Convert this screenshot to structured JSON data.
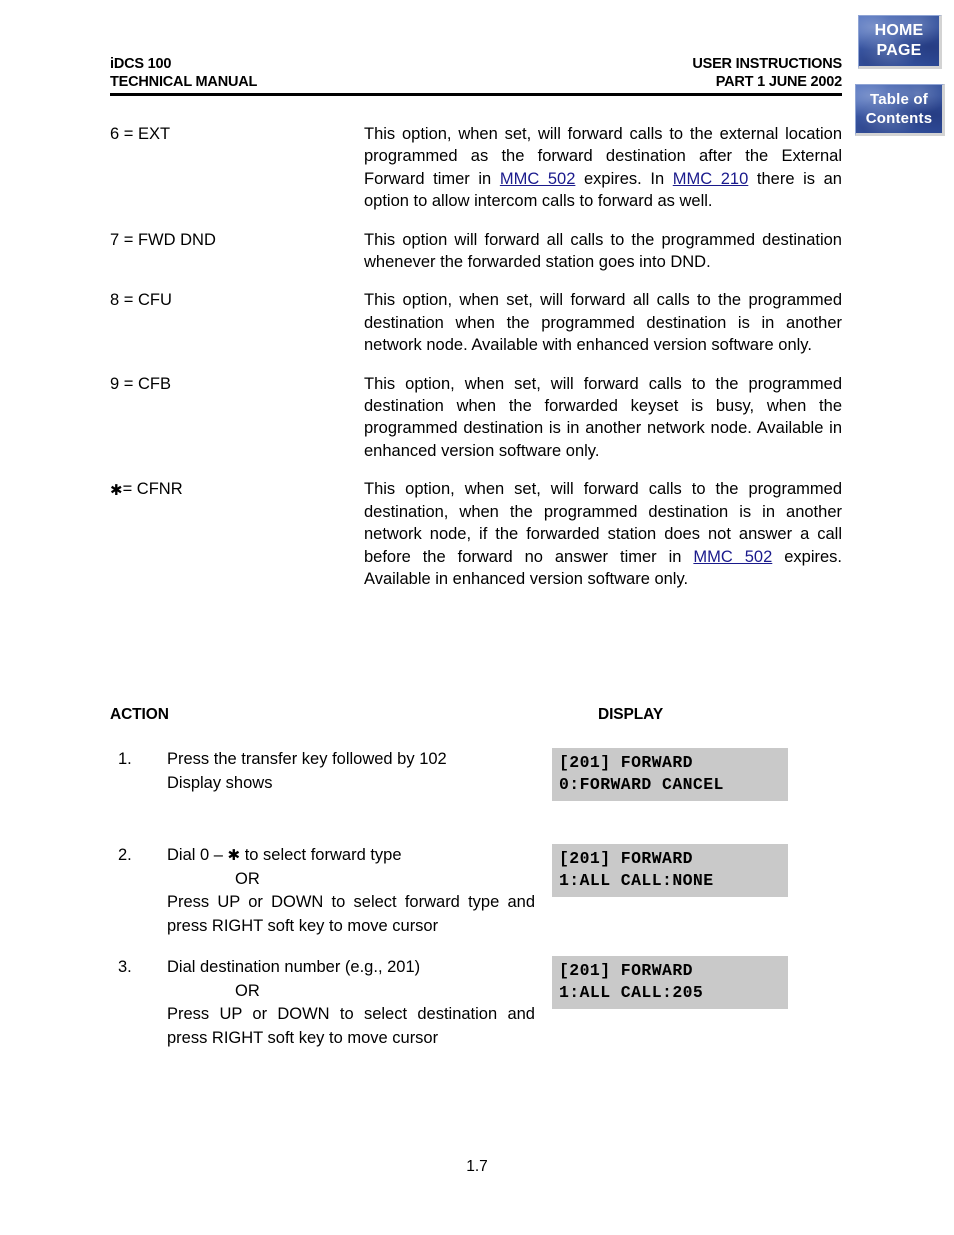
{
  "header": {
    "left_line1": "iDCS 100",
    "left_line2": "TECHNICAL MANUAL",
    "right_line1": "USER INSTRUCTIONS",
    "right_line2": "PART 1   JUNE  2002"
  },
  "nav_buttons": {
    "home_page": {
      "line1": "HOME",
      "line2": "PAGE",
      "color": "#3a5cab",
      "text_color": "#ffffff"
    },
    "table_of_contents": {
      "line1": "Table of",
      "line2": "Contents",
      "color": "#3a5cab",
      "text_color": "#ffffff"
    }
  },
  "link_color": "#1a1a8c",
  "display_bg_color": "#c9c9c9",
  "options": [
    {
      "term": "6 = EXT",
      "star": false,
      "definition_parts": [
        {
          "text": "This option, when set, will forward calls to the external location programmed as the forward destination after the External Forward timer in ",
          "link": false
        },
        {
          "text": "MMC 502",
          "link": true
        },
        {
          "text": " expires. In ",
          "link": false
        },
        {
          "text": "MMC 210",
          "link": true
        },
        {
          "text": " there is an option to allow intercom calls to forward as well.",
          "link": false
        }
      ]
    },
    {
      "term": "7 = FWD DND",
      "star": false,
      "definition_parts": [
        {
          "text": "This option will forward all calls to the programmed destination whenever the forwarded station goes into DND.",
          "link": false
        }
      ]
    },
    {
      "term": "8 = CFU",
      "star": false,
      "definition_parts": [
        {
          "text": "This option, when set, will forward all calls to the programmed destination when the programmed destination is in another network node. Available with enhanced version software only.",
          "link": false
        }
      ]
    },
    {
      "term": "9 = CFB",
      "star": false,
      "definition_parts": [
        {
          "text": "This option, when set, will forward calls to the programmed destination when the forwarded keyset is busy, when the programmed destination is in another network node. Available in enhanced version software only.",
          "link": false
        }
      ]
    },
    {
      "term": "= CFNR",
      "star": true,
      "star_glyph": "✱",
      "definition_parts": [
        {
          "text": "This option, when set, will forward calls to the programmed destination, when the programmed destination is in another network node, if the forwarded station does not answer a call before the forward no answer timer in ",
          "link": false
        },
        {
          "text": "MMC 502",
          "link": true
        },
        {
          "text": " expires. Available in enhanced version software only.",
          "link": false
        }
      ]
    }
  ],
  "procedure": {
    "column_headers": {
      "action": "ACTION",
      "display": "DISPLAY"
    },
    "steps": [
      {
        "number": "1.",
        "lines": [
          {
            "text": "Press the transfer key followed by 102",
            "style": "normal"
          },
          {
            "text": "Display shows",
            "style": "normal"
          }
        ],
        "display": {
          "line1": "[201] FORWARD",
          "line2": "0:FORWARD CANCEL"
        }
      },
      {
        "number": "2.",
        "lines": [
          {
            "text": "Dial 0 – ✱ to select forward type",
            "style": "star-line",
            "pre_star": "Dial 0 – ",
            "star_glyph": "✱",
            "post_star": " to select forward type"
          },
          {
            "text": "OR",
            "style": "or"
          },
          {
            "text": "Press UP or DOWN to select forward type and press RIGHT soft key to move cursor",
            "style": "justified"
          }
        ],
        "display": {
          "line1": "[201] FORWARD",
          "line2": "1:ALL CALL:NONE"
        }
      },
      {
        "number": "3.",
        "lines": [
          {
            "text": "Dial destination number (e.g., 201)",
            "style": "normal"
          },
          {
            "text": "OR",
            "style": "or"
          },
          {
            "text": "Press UP or DOWN to select destination and press RIGHT soft key to move cursor",
            "style": "justified"
          }
        ],
        "display": {
          "line1": "[201] FORWARD",
          "line2": "1:ALL CALL:205"
        }
      }
    ]
  },
  "footer": {
    "page_number": "1.7"
  }
}
